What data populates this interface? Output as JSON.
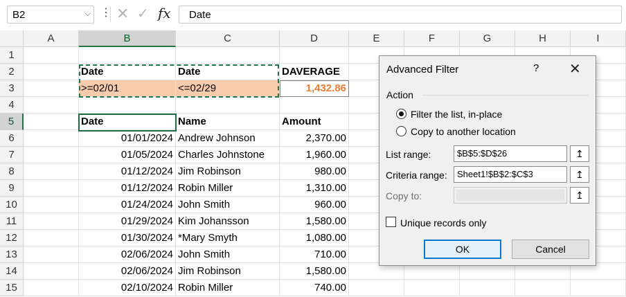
{
  "namebox": "B2",
  "formula_bar": "Date",
  "columns": [
    "A",
    "B",
    "C",
    "D",
    "E",
    "F",
    "G",
    "H",
    "I"
  ],
  "rows": [
    "1",
    "2",
    "3",
    "4",
    "5",
    "6",
    "7",
    "8",
    "9",
    "10",
    "11",
    "12",
    "13",
    "14",
    "15"
  ],
  "criteria": {
    "h1": "Date",
    "h2": "Date",
    "h3": "DAVERAGE",
    "c1": ">=02/01",
    "c2": "<=02/29",
    "result": "1,432.86"
  },
  "table": {
    "headers": [
      "Date",
      "Name",
      "Amount"
    ],
    "rows": [
      [
        "01/01/2024",
        "Andrew Johnson",
        "2,370.00"
      ],
      [
        "01/05/2024",
        "Charles Johnstone",
        "1,960.00"
      ],
      [
        "01/12/2024",
        "Jim Robinson",
        "980.00"
      ],
      [
        "01/12/2024",
        "Robin Miller",
        "1,310.00"
      ],
      [
        "01/24/2024",
        "John Smith",
        "960.00"
      ],
      [
        "01/29/2024",
        "Kim Johansson",
        "1,580.00"
      ],
      [
        "01/30/2024",
        "*Mary Smyth",
        "1,080.00"
      ],
      [
        "02/06/2024",
        "John Smith",
        "710.00"
      ],
      [
        "02/06/2024",
        "Jim Robinson",
        "1,580.00"
      ],
      [
        "02/10/2024",
        "Robin Miller",
        "740.00"
      ]
    ]
  },
  "dialog": {
    "title": "Advanced Filter",
    "help": "?",
    "close": "✕",
    "action_label": "Action",
    "option_filter": "Filter the list, in-place",
    "option_copy": "Copy to another location",
    "list_range_label": "List range:",
    "list_range_value": "$B$5:$D$26",
    "criteria_range_label": "Criteria range:",
    "criteria_range_value": "Sheet1!$B$2:$C$3",
    "copy_to_label": "Copy to:",
    "unique_label": "Unique records only",
    "ok": "OK",
    "cancel": "Cancel"
  },
  "icons": {
    "up_arrow": "↥"
  }
}
